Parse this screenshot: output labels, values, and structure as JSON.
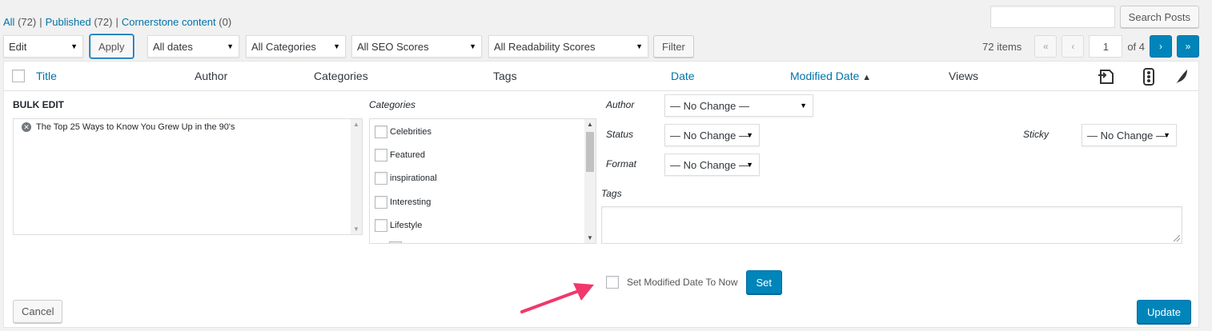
{
  "views": {
    "all_label": "All",
    "all_count": "(72)",
    "published_label": "Published",
    "published_count": "(72)",
    "cornerstone_label": "Cornerstone content",
    "cornerstone_count": "(0)",
    "separator": "|"
  },
  "search": {
    "value": "",
    "button_label": "Search Posts"
  },
  "tablenav": {
    "bulk_action": "Edit",
    "apply_label": "Apply",
    "dates": "All dates",
    "categories": "All Categories",
    "seo_scores": "All SEO Scores",
    "readability_scores": "All Readability Scores",
    "filter_label": "Filter"
  },
  "pagination": {
    "items": "72 items",
    "first": "«",
    "prev": "‹",
    "current_page": "1",
    "of_total": "of 4",
    "next": "›",
    "last": "»"
  },
  "table_head": {
    "title": "Title",
    "author": "Author",
    "categories": "Categories",
    "tags": "Tags",
    "date": "Date",
    "modified_date": "Modified Date",
    "sort_indicator": "▲",
    "views": "Views"
  },
  "bulk_edit": {
    "heading": "BULK EDIT",
    "selected_post": "The Top 25 Ways to Know You Grew Up in the 90's",
    "categories_label": "Categories",
    "categories": [
      "Celebrities",
      "Featured",
      "inspirational",
      "Interesting",
      "Lifestyle"
    ],
    "author_label": "Author",
    "author_value": "— No Change —",
    "status_label": "Status",
    "status_value": "— No Change —",
    "format_label": "Format",
    "format_value": "— No Change —",
    "sticky_label": "Sticky",
    "sticky_value": "— No Change —",
    "tags_label": "Tags",
    "tags_value": "",
    "set_modified_label": "Set Modified Date To Now",
    "set_label": "Set",
    "cancel_label": "Cancel",
    "update_label": "Update"
  },
  "colors": {
    "link": "#0073aa",
    "primary_button": "#0085ba",
    "annotation_arrow": "#f0386b"
  }
}
